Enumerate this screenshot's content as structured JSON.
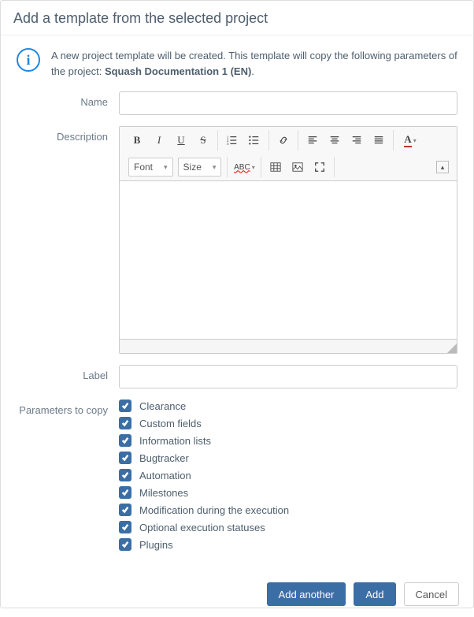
{
  "dialog": {
    "title": "Add a template from the selected project",
    "info_prefix": "A new project template will be created. This template will copy the following parameters of the project: ",
    "project_name": "Squash Documentation 1 (EN)",
    "info_suffix": "."
  },
  "form": {
    "name_label": "Name",
    "name_value": "",
    "description_label": "Description",
    "label_label": "Label",
    "label_value": "",
    "params_label": "Parameters to copy"
  },
  "editor": {
    "font_selector": "Font",
    "size_selector": "Size"
  },
  "params": {
    "items": [
      {
        "label": "Clearance",
        "checked": true
      },
      {
        "label": "Custom fields",
        "checked": true
      },
      {
        "label": "Information lists",
        "checked": true
      },
      {
        "label": "Bugtracker",
        "checked": true
      },
      {
        "label": "Automation",
        "checked": true
      },
      {
        "label": "Milestones",
        "checked": true
      },
      {
        "label": "Modification during the execution",
        "checked": true
      },
      {
        "label": "Optional execution statuses",
        "checked": true
      },
      {
        "label": "Plugins",
        "checked": true
      }
    ]
  },
  "buttons": {
    "add_another": "Add another",
    "add": "Add",
    "cancel": "Cancel"
  }
}
